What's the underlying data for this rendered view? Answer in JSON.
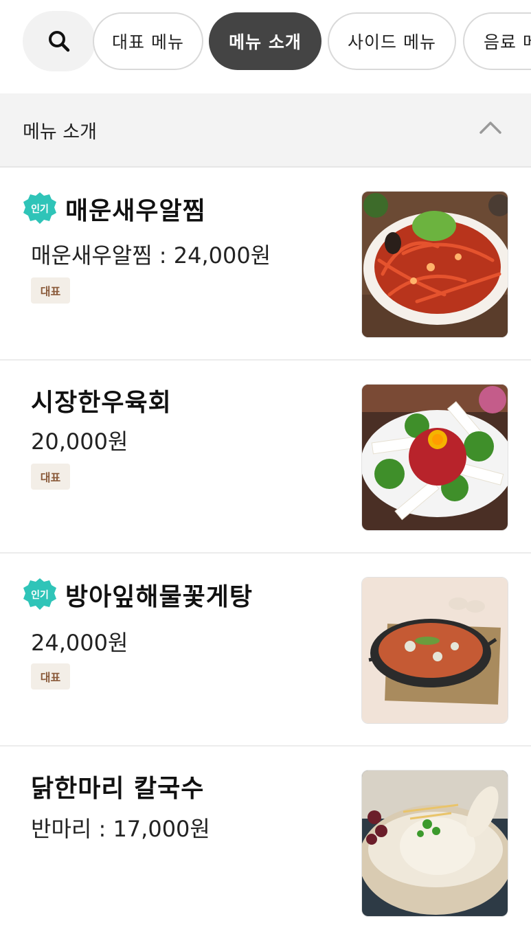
{
  "tabs": {
    "items": [
      {
        "label": "대표 메뉴",
        "active": false
      },
      {
        "label": "메뉴 소개",
        "active": true
      },
      {
        "label": "사이드 메뉴",
        "active": false
      },
      {
        "label": "음료 메뉴",
        "active": false
      }
    ]
  },
  "section": {
    "title": "메뉴 소개"
  },
  "menu": [
    {
      "name": "매운새우알찜",
      "price": "매운새우알찜 : 24,000원",
      "popular": true,
      "popular_label": "인기",
      "tag": "대표",
      "image": "spicy-shrimp-dish"
    },
    {
      "name": "시장한우육회",
      "price": "20,000원",
      "popular": false,
      "tag": "대표",
      "image": "beef-tartare-dish"
    },
    {
      "name": "방아잎해물꽃게탕",
      "price": "24,000원",
      "popular": true,
      "popular_label": "인기",
      "tag": "대표",
      "image": "seafood-crab-stew"
    },
    {
      "name": "닭한마리 칼국수",
      "price": "반마리 : 17,000원",
      "popular": false,
      "tag": "",
      "image": "chicken-noodle-soup"
    }
  ],
  "colors": {
    "active_tab": "#444444",
    "popular_badge": "#2fc4b8",
    "tag_bg": "#f3eee7",
    "tag_text": "#8a5a3a"
  }
}
